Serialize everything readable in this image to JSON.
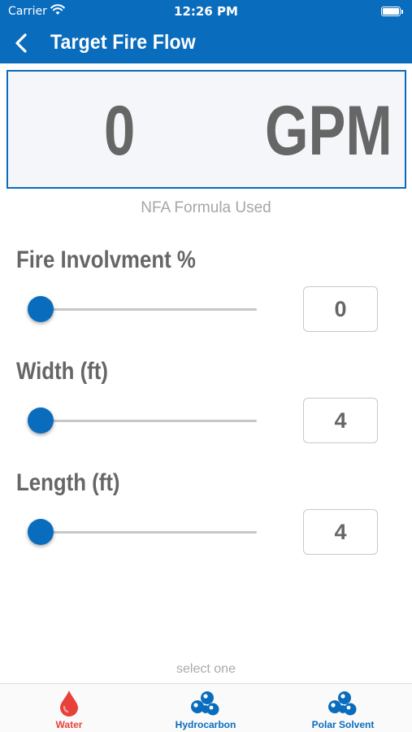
{
  "status_bar": {
    "carrier": "Carrier",
    "time": "12:26 PM"
  },
  "nav": {
    "title": "Target Fire Flow",
    "back_icon": "chevron-left-icon"
  },
  "result": {
    "value": "0",
    "unit": "GPM"
  },
  "formula_note": "NFA Formula Used",
  "sliders": [
    {
      "label": "Fire Involvment %",
      "value": "0",
      "level": 0.0
    },
    {
      "label": "Width (ft)",
      "value": "4",
      "level": 0.0
    },
    {
      "label": "Length (ft)",
      "value": "4",
      "level": 0.0
    }
  ],
  "select_hint": "select one",
  "tabs": [
    {
      "label": "Water",
      "icon": "water-drop-icon",
      "selected": true
    },
    {
      "label": "Hydrocarbon",
      "icon": "hydrocarbon-icon",
      "selected": false
    },
    {
      "label": "Polar Solvent",
      "icon": "polar-solvent-icon",
      "selected": false
    }
  ],
  "colors": {
    "primary": "#0a6cbd",
    "active_tab": "#e8403a",
    "text": "#666666"
  }
}
